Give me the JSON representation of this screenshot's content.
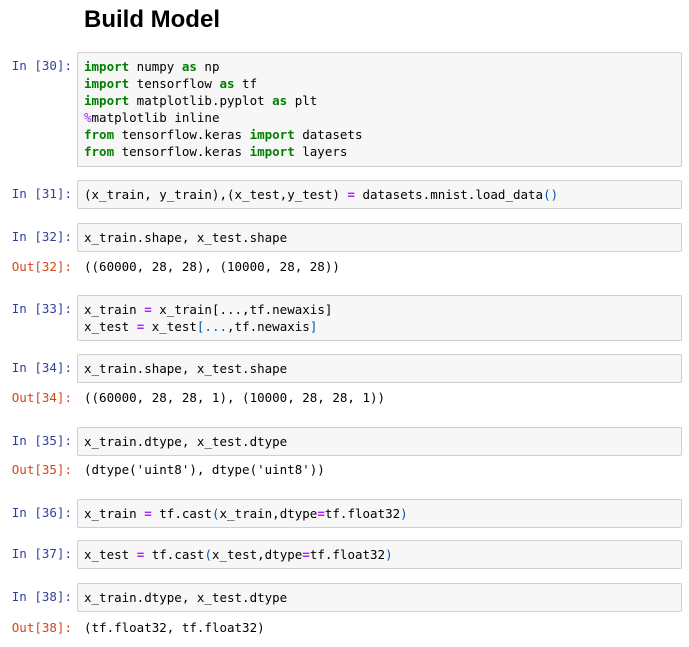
{
  "heading": "Build Model",
  "cells": [
    {
      "in_prompt": "In [30]:",
      "code": [
        [
          {
            "t": "import",
            "c": "kw"
          },
          {
            "t": " numpy "
          },
          {
            "t": "as",
            "c": "kw"
          },
          {
            "t": " np"
          }
        ],
        [
          {
            "t": "import",
            "c": "kw"
          },
          {
            "t": " tensorflow "
          },
          {
            "t": "as",
            "c": "kw"
          },
          {
            "t": " tf"
          }
        ],
        [
          {
            "t": "import",
            "c": "kw"
          },
          {
            "t": " matplotlib.pyplot "
          },
          {
            "t": "as",
            "c": "kw"
          },
          {
            "t": " plt"
          }
        ],
        [
          {
            "t": "%",
            "c": "mg"
          },
          {
            "t": "matplotlib inline"
          }
        ],
        [
          {
            "t": "from",
            "c": "kw"
          },
          {
            "t": " tensorflow.keras "
          },
          {
            "t": "import",
            "c": "kw"
          },
          {
            "t": " datasets"
          }
        ],
        [
          {
            "t": "from",
            "c": "kw"
          },
          {
            "t": " tensorflow.keras "
          },
          {
            "t": "import",
            "c": "kw"
          },
          {
            "t": " layers"
          }
        ]
      ]
    },
    {
      "in_prompt": "In [31]:",
      "code": [
        [
          {
            "t": "(x_train, y_train),(x_test,y_test) "
          },
          {
            "t": "=",
            "c": "op"
          },
          {
            "t": " datasets.mnist.load_data"
          },
          {
            "t": "()",
            "c": "br"
          }
        ]
      ]
    },
    {
      "in_prompt": "In [32]:",
      "code": [
        [
          {
            "t": "x_train.shape, x_test.shape"
          }
        ]
      ],
      "out_prompt": "Out[32]:",
      "output": "((60000, 28, 28), (10000, 28, 28))"
    },
    {
      "in_prompt": "In [33]:",
      "code": [
        [
          {
            "t": "x_train "
          },
          {
            "t": "=",
            "c": "op"
          },
          {
            "t": " x_train[...,tf.newaxis]"
          }
        ],
        [
          {
            "t": "x_test "
          },
          {
            "t": "=",
            "c": "op"
          },
          {
            "t": " x_test"
          },
          {
            "t": "[...",
            "c": "br"
          },
          {
            "t": ",tf.newaxis"
          },
          {
            "t": "]",
            "c": "br"
          }
        ]
      ]
    },
    {
      "in_prompt": "In [34]:",
      "code": [
        [
          {
            "t": "x_train.shape, x_test.shape"
          }
        ]
      ],
      "out_prompt": "Out[34]:",
      "output": "((60000, 28, 28, 1), (10000, 28, 28, 1))"
    },
    {
      "in_prompt": "In [35]:",
      "code": [
        [
          {
            "t": "x_train.dtype, x_test.dtype"
          }
        ]
      ],
      "out_prompt": "Out[35]:",
      "output": "(dtype('uint8'), dtype('uint8'))"
    },
    {
      "in_prompt": "In [36]:",
      "code": [
        [
          {
            "t": "x_train "
          },
          {
            "t": "=",
            "c": "op"
          },
          {
            "t": " tf.cast"
          },
          {
            "t": "(",
            "c": "br"
          },
          {
            "t": "x_train,dtype"
          },
          {
            "t": "=",
            "c": "op"
          },
          {
            "t": "tf.float32"
          },
          {
            "t": ")",
            "c": "br"
          }
        ]
      ]
    },
    {
      "in_prompt": "In [37]:",
      "code": [
        [
          {
            "t": "x_test "
          },
          {
            "t": "=",
            "c": "op"
          },
          {
            "t": " tf.cast"
          },
          {
            "t": "(",
            "c": "br"
          },
          {
            "t": "x_test,dtype"
          },
          {
            "t": "=",
            "c": "op"
          },
          {
            "t": "tf.float32"
          },
          {
            "t": ")",
            "c": "br"
          }
        ]
      ]
    },
    {
      "in_prompt": "In [38]:",
      "code": [
        [
          {
            "t": "x_train.dtype, x_test.dtype"
          }
        ]
      ],
      "out_prompt": "Out[38]:",
      "output": "(tf.float32, tf.float32)"
    }
  ]
}
